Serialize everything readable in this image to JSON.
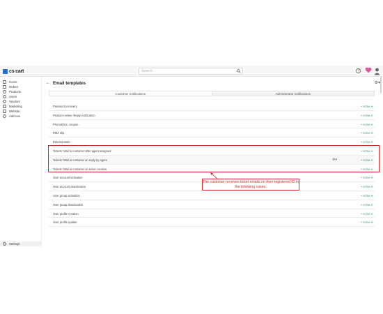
{
  "app": {
    "logo_text": "cs cart"
  },
  "search": {
    "placeholder": "Search"
  },
  "sidebar": {
    "items": [
      {
        "label": "Home",
        "icon": "home-icon"
      },
      {
        "label": "Orders",
        "icon": "orders-icon"
      },
      {
        "label": "Products",
        "icon": "products-icon"
      },
      {
        "label": "Users",
        "icon": "users-icon"
      },
      {
        "label": "Vendors",
        "icon": "vendors-icon"
      },
      {
        "label": "Marketing",
        "icon": "marketing-icon"
      },
      {
        "label": "Website",
        "icon": "website-icon"
      },
      {
        "label": "Add-ons",
        "icon": "addons-icon"
      }
    ],
    "settings_label": "Settings"
  },
  "page": {
    "title": "Email templates"
  },
  "tabs": [
    {
      "label": "Customer notifications",
      "active": true
    },
    {
      "label": "Administrator notifications",
      "active": false
    }
  ],
  "templates": [
    {
      "name": "Password recovery",
      "status": "• Active ▾"
    },
    {
      "name": "Product review: Reply notification",
      "status": "• Active ▾"
    },
    {
      "name": "Promotions: coupon",
      "status": "• Active ▾"
    },
    {
      "name": "RMA slip",
      "status": "• Active ▾"
    },
    {
      "name": "Return/points",
      "status": "• Active ▾"
    },
    {
      "name": "Tickets: Mail to customer after agent assigned",
      "status": "• Active ▾"
    },
    {
      "name": "Tickets: Mail to customer on reply by agent",
      "status": "• Active ▾"
    },
    {
      "name": "Tickets: Mail to customer on ticket creation",
      "status": "• Active ▾"
    },
    {
      "name": "User account activation",
      "status": "• Active ▾"
    },
    {
      "name": "User account deactivation",
      "status": "• Active ▾"
    },
    {
      "name": "User group activation",
      "status": "• Active ▾"
    },
    {
      "name": "User group deactivation",
      "status": "• Active ▾"
    },
    {
      "name": "User profile creation",
      "status": "• Active ▾"
    },
    {
      "name": "User profile update",
      "status": "• Active ▾"
    }
  ],
  "annotation": {
    "text": "The customer receives ticket emails on their registered ID in the following cases."
  },
  "colors": {
    "accent": "#2a6ecb",
    "active_status": "#3aa56a",
    "annotation": "#c82a2a"
  }
}
